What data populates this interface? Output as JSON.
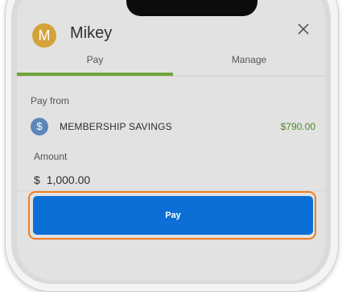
{
  "header": {
    "avatar_initial": "M",
    "user_name": "Mikey"
  },
  "tabs": [
    {
      "label": "Pay",
      "active": true
    },
    {
      "label": "Manage",
      "active": false
    }
  ],
  "pay_from": {
    "label": "Pay from",
    "account_name": "MEMBERSHIP SAVINGS",
    "balance": "$790.00",
    "account_icon": "dollar-icon"
  },
  "amount": {
    "label": "Amount",
    "currency_symbol": "$",
    "value": "1,000.00"
  },
  "actions": {
    "pay_label": "Pay"
  },
  "colors": {
    "accent_green": "#6fa43a",
    "balance_green": "#4f8a2b",
    "primary_blue": "#0b6fd6",
    "highlight_orange": "#ef7d22",
    "avatar_gold": "#d4a23a"
  }
}
